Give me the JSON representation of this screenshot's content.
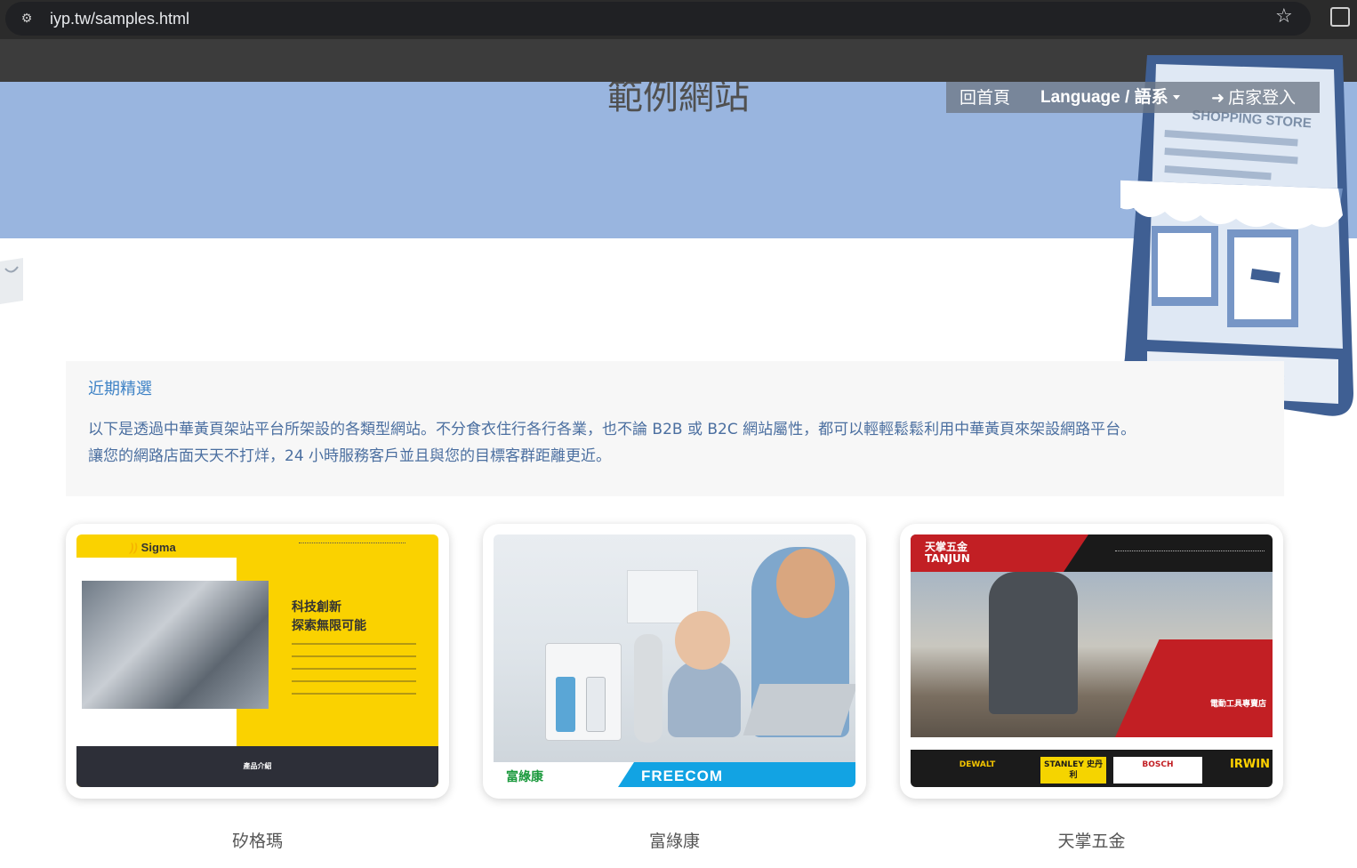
{
  "browser": {
    "url": "iyp.tw/samples.html"
  },
  "hero": {
    "title": "範例網站"
  },
  "nav": {
    "home": "回首頁",
    "language": "Language / 語系",
    "login": "店家登入"
  },
  "intro": {
    "title": "近期精選",
    "line1": "以下是透過中華黃頁架站平台所架設的各類型網站。不分食衣住行各行各業，也不論 B2B 或 B2C 網站屬性，都可以輕輕鬆鬆利用中華黃頁來架設網路平台。",
    "line2": "讓您的網路店面天天不打烊，24 小時服務客戶並且與您的目標客群距離更近。"
  },
  "samples": [
    {
      "caption": "矽格瑪",
      "thumb": {
        "logo": "Sigma",
        "headline1": "科技創新",
        "headline2": "探索無限可能",
        "footer": "產品介紹"
      }
    },
    {
      "caption": "富綠康",
      "thumb": {
        "logo_left": "富綠康",
        "logo_right": "FREECOM"
      }
    },
    {
      "caption": "天掌五金",
      "thumb": {
        "logo": "天掌五金",
        "logo_en": "TANJUN",
        "banner": "電動工具專賣店",
        "brands": [
          "DEWALT",
          "STANLEY 史丹利",
          "BOSCH",
          "IRWIN"
        ]
      }
    }
  ],
  "colors": {
    "hero_bg": "#99b5df",
    "link_blue": "#3f83c6",
    "text_blue": "#4b6fa0"
  }
}
